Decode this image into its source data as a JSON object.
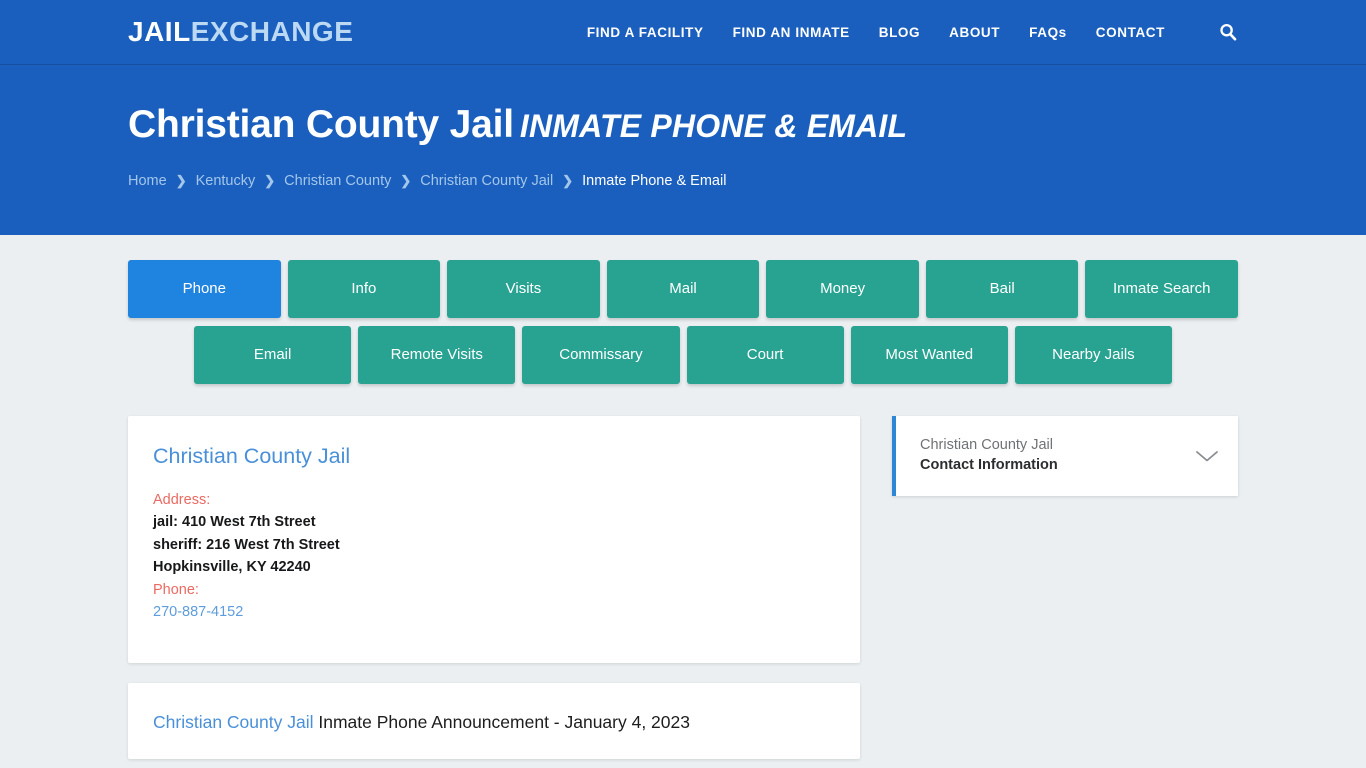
{
  "header": {
    "logo": {
      "part1": "JAIL",
      "part2": "EXCHANGE"
    },
    "nav": [
      {
        "label": "FIND A FACILITY",
        "name": "nav-find-a-facility"
      },
      {
        "label": "FIND AN INMATE",
        "name": "nav-find-an-inmate"
      },
      {
        "label": "BLOG",
        "name": "nav-blog"
      },
      {
        "label": "ABOUT",
        "name": "nav-about"
      },
      {
        "label": "FAQs",
        "name": "nav-faqs"
      },
      {
        "label": "CONTACT",
        "name": "nav-contact"
      }
    ],
    "search_icon": "search-icon"
  },
  "title": {
    "main": "Christian County Jail",
    "sub": "INMATE PHONE & EMAIL"
  },
  "breadcrumb": {
    "separator": "❯",
    "items": [
      {
        "label": "Home",
        "current": false
      },
      {
        "label": "Kentucky",
        "current": false
      },
      {
        "label": "Christian County",
        "current": false
      },
      {
        "label": "Christian County Jail",
        "current": false
      },
      {
        "label": "Inmate Phone & Email",
        "current": true
      }
    ]
  },
  "tabs": {
    "row1": [
      {
        "label": "Phone",
        "active": true
      },
      {
        "label": "Info",
        "active": false
      },
      {
        "label": "Visits",
        "active": false
      },
      {
        "label": "Mail",
        "active": false
      },
      {
        "label": "Money",
        "active": false
      },
      {
        "label": "Bail",
        "active": false
      },
      {
        "label": "Inmate Search",
        "active": false
      }
    ],
    "row2": [
      {
        "label": "Email",
        "active": false
      },
      {
        "label": "Remote Visits",
        "active": false
      },
      {
        "label": "Commissary",
        "active": false
      },
      {
        "label": "Court",
        "active": false
      },
      {
        "label": "Most Wanted",
        "active": false
      },
      {
        "label": "Nearby Jails",
        "active": false
      }
    ]
  },
  "facility_card": {
    "name": "Christian County Jail",
    "address_label": "Address:",
    "address_lines": [
      "jail: 410 West 7th Street",
      "sheriff: 216 West 7th Street",
      "Hopkinsville, KY 42240"
    ],
    "phone_label": "Phone:",
    "phone": "270-887-4152"
  },
  "announcement": {
    "link_text": "Christian County Jail",
    "rest_text": " Inmate Phone Announcement - January 4, 2023"
  },
  "sidebar": {
    "accordion": {
      "line1": "Christian County Jail",
      "line2": "Contact Information",
      "chevron_icon": "chevron-down-icon"
    }
  },
  "colors": {
    "header_blue": "#1a5fbe",
    "tab_teal": "#28a392",
    "tab_active_blue": "#1f83e0",
    "link_blue": "#4a90d9",
    "label_red": "#ea6a62",
    "page_bg": "#eceff1",
    "accent_border": "#2d87d4"
  }
}
